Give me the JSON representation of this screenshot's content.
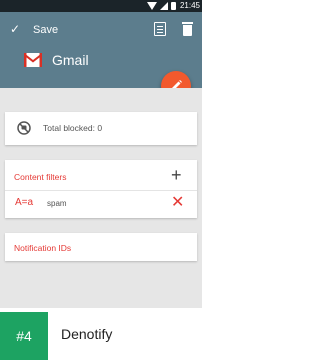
{
  "status_bar": {
    "time": "21:45"
  },
  "app_bar": {
    "confirm_icon": "check-icon",
    "save_label": "Save",
    "actions": [
      "list-icon",
      "trash-icon"
    ],
    "app_title": "Gmail",
    "app_icon": "gmail-logo"
  },
  "fab": {
    "icon": "pencil-icon",
    "color": "#f2592d"
  },
  "blocked_card": {
    "icon": "block-icon",
    "label": "Total blocked: 0"
  },
  "content_filters": {
    "title": "Content filters",
    "add_icon": "plus-icon",
    "items": [
      {
        "type_label": "A=a",
        "value": "spam",
        "remove_icon": "close-icon"
      }
    ]
  },
  "notification_ids": {
    "title": "Notification IDs"
  },
  "footer": {
    "rank": "#4",
    "app_name": "Denotify"
  },
  "colors": {
    "app_bar": "#5c7d8d",
    "accent": "#e53935",
    "fab": "#f2592d",
    "badge": "#1da362"
  }
}
